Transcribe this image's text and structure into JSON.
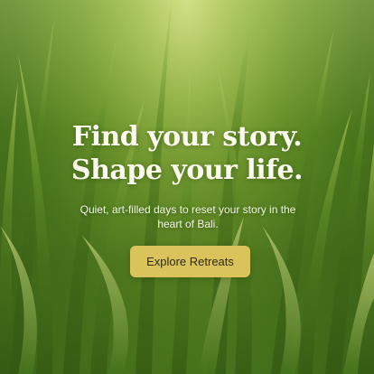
{
  "hero": {
    "headline_line1": "Find your story.",
    "headline_line2": "Shape your life.",
    "subtitle": "Quiet, art-filled days to reset your story in the heart of Bali.",
    "cta_label": "Explore Retreats"
  },
  "colors": {
    "cta_background": "#d9c35a",
    "headline_text": "#fbfaee",
    "grass_dark": "#3c6518",
    "grass_light": "#c8d97a"
  }
}
